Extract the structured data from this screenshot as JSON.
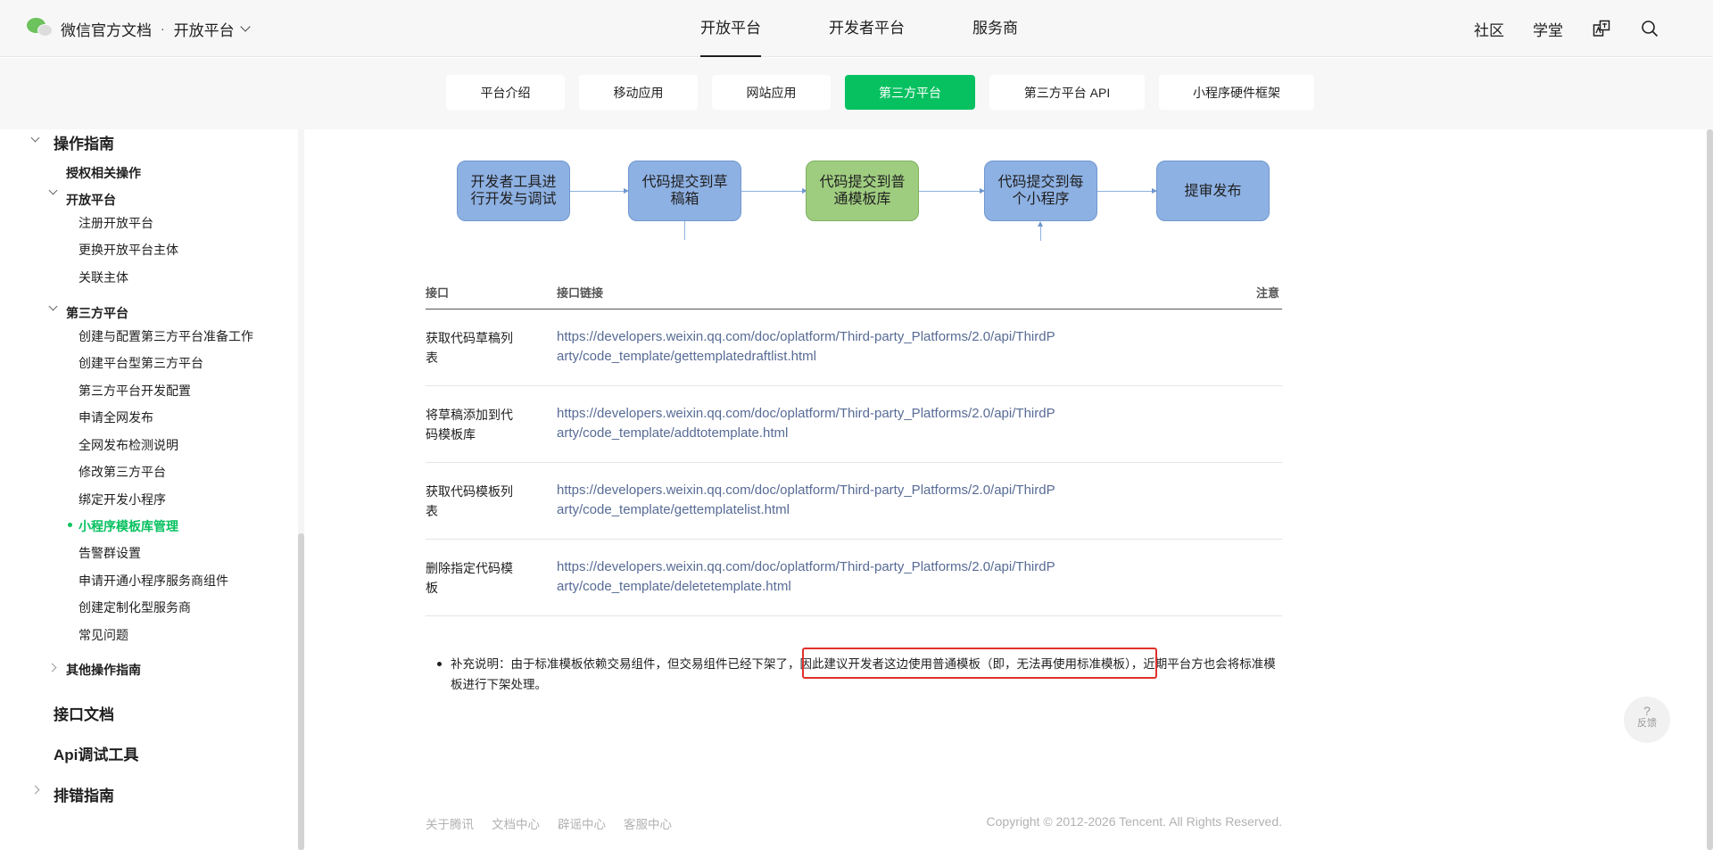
{
  "header": {
    "brand": "微信官方文档",
    "brand_dot": "·",
    "brand_sub": "开放平台",
    "nav": [
      "开放平台",
      "开发者平台",
      "服务商"
    ],
    "right_links": [
      "社区",
      "学堂"
    ],
    "icons": [
      "translate-icon",
      "search-icon"
    ]
  },
  "subnav": [
    "平台介绍",
    "移动应用",
    "网站应用",
    "第三方平台",
    "第三方平台 API",
    "小程序硬件框架"
  ],
  "subnav_active": "第三方平台",
  "sidebar": {
    "section_title": "操作指南",
    "auth_ops": "授权相关操作",
    "open_platform": {
      "title": "开放平台",
      "items": [
        "注册开放平台",
        "更换开放平台主体",
        "关联主体"
      ]
    },
    "third_party": {
      "title": "第三方平台",
      "items": [
        "创建与配置第三方平台准备工作",
        "创建平台型第三方平台",
        "第三方平台开发配置",
        "申请全网发布",
        "全网发布检测说明",
        "修改第三方平台",
        "绑定开发小程序",
        "小程序模板库管理",
        "告警群设置",
        "申请开通小程序服务商组件",
        "创建定制化型服务商",
        "常见问题"
      ]
    },
    "other_ops": "其他操作指南",
    "api_docs": "接口文档",
    "api_debug": "Api调试工具",
    "troubleshoot": "排错指南"
  },
  "flowchart": {
    "steps": [
      "开发者工具进行开发与调试",
      "代码提交到草稿箱",
      "代码提交到普通模板库",
      "代码提交到每个小程序",
      "提审发布"
    ]
  },
  "table": {
    "headers": [
      "接口",
      "接口链接",
      "注意"
    ],
    "rows": [
      {
        "name": "获取代码草稿列表",
        "link": "https://developers.weixin.qq.com/doc/oplatform/Third-party_Platforms/2.0/api/ThirdParty/code_template/gettemplatedraftlist.html"
      },
      {
        "name": "将草稿添加到代码模板库",
        "link": "https://developers.weixin.qq.com/doc/oplatform/Third-party_Platforms/2.0/api/ThirdParty/code_template/addtotemplate.html"
      },
      {
        "name": "获取代码模板列表",
        "link": "https://developers.weixin.qq.com/doc/oplatform/Third-party_Platforms/2.0/api/ThirdParty/code_template/gettemplatelist.html"
      },
      {
        "name": "删除指定代码模板",
        "link": "https://developers.weixin.qq.com/doc/oplatform/Third-party_Platforms/2.0/api/ThirdParty/code_template/deletetemplate.html"
      }
    ]
  },
  "note": {
    "text": "补充说明：由于标准模板依赖交易组件，但交易组件已经下架了，因此建议开发者这边使用普通模板（即，无法再使用标准模板），近期平台方也会将标准模板进行下架处理。"
  },
  "footer": {
    "links": [
      "关于腾讯",
      "文档中心",
      "辟谣中心",
      "客服中心"
    ],
    "copyright": "Copyright © 2012-2026 Tencent. All Rights Reserved."
  },
  "feedback": {
    "symbol": "?",
    "label": "反馈"
  },
  "colors": {
    "accent": "#07c160",
    "link": "#576b95",
    "highlight": "#e0302b",
    "flow_blue": "#8eb1e3",
    "flow_green": "#9fcd80"
  }
}
